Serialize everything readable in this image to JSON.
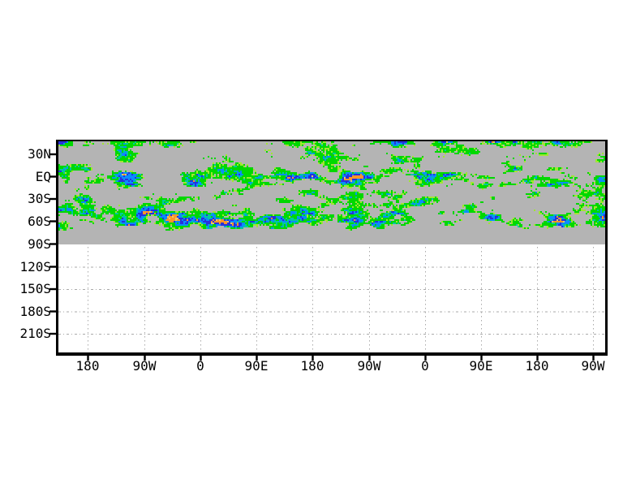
{
  "chart_data": {
    "type": "heatmap",
    "title": "",
    "x_axis": {
      "tick_labels": [
        "180",
        "90W",
        "0",
        "90E",
        "180",
        "90W",
        "0",
        "90E",
        "180",
        "90W"
      ],
      "note": "longitude axis wrapping more than two full cycles"
    },
    "y_axis": {
      "tick_labels": [
        "30N",
        "EQ",
        "30S",
        "60S",
        "90S",
        "120S",
        "150S",
        "180S",
        "210S"
      ]
    },
    "grid": {
      "visible": true,
      "color": "#aaaaaa",
      "horizontal_style": "dash-dot",
      "vertical_style": "dotted",
      "shown_only_below": "90S"
    },
    "axis_color": "#000000",
    "field": {
      "undef_color": "#b4b4b4",
      "palette": {
        "yellow_green": "#a0e632",
        "green": "#00d800",
        "teal": "#00c8a0",
        "light_blue": "#0a8cff",
        "dark_blue": "#2830dc",
        "orange": "#ff9628",
        "sand": "#f0c864"
      },
      "visible_structure": {
        "speckled_filament_field": "from plot top edge down to about 65S, full width",
        "dense_bands": [
          "top edge",
          "30N",
          "equator",
          "30S to 65S (densest, most orange/dark-blue cores)"
        ],
        "solid_undef_band": "about 65S down to 90S is solid gray",
        "below_90S": "empty white plot area with gridlines only"
      },
      "seed": 12
    }
  }
}
